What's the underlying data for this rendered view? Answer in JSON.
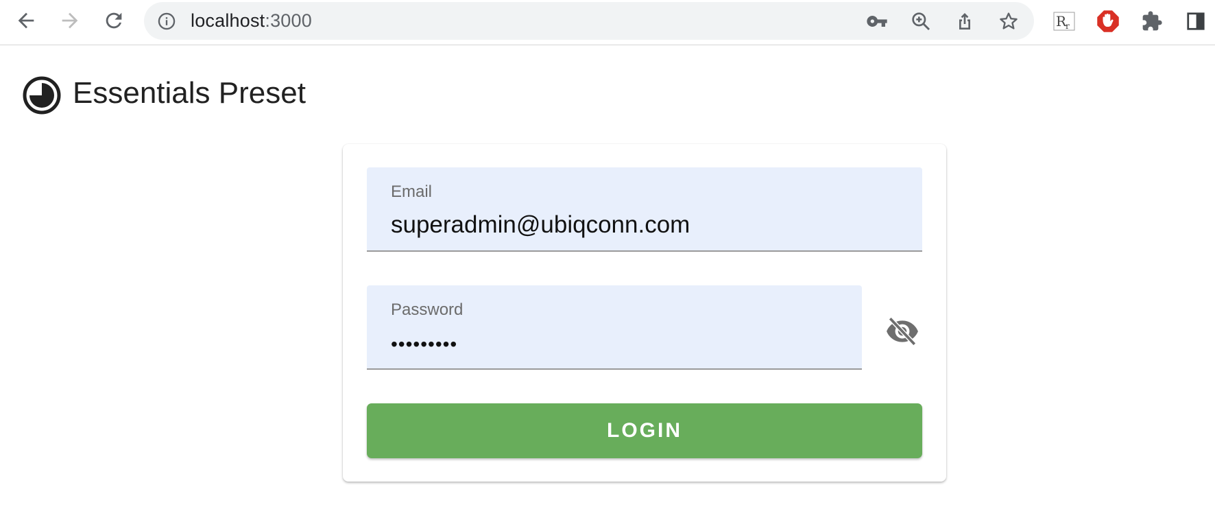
{
  "browser": {
    "url_host": "localhost",
    "url_port": ":3000",
    "icons": {
      "back": "back-arrow-icon",
      "forward": "forward-arrow-icon",
      "reload": "reload-icon",
      "site_info": "info-icon",
      "password_key": "key-icon",
      "zoom": "zoom-icon",
      "share": "share-icon",
      "bookmark": "star-icon",
      "extensions": [
        "rr-extension-icon",
        "adblock-icon",
        "puzzle-icon",
        "sidepanel-icon"
      ]
    }
  },
  "app": {
    "title": "Essentials Preset",
    "logo_icon": "pie-logo-icon"
  },
  "login": {
    "email_label": "Email",
    "email_value": "superadmin@ubiqconn.com",
    "password_label": "Password",
    "password_masked": "•••••••••",
    "visibility_icon": "eye-off-icon",
    "login_label": "LOGIN"
  },
  "colors": {
    "field_bg": "#e8effc",
    "button_bg": "#68ad5b",
    "adblock_red": "#d93025"
  }
}
